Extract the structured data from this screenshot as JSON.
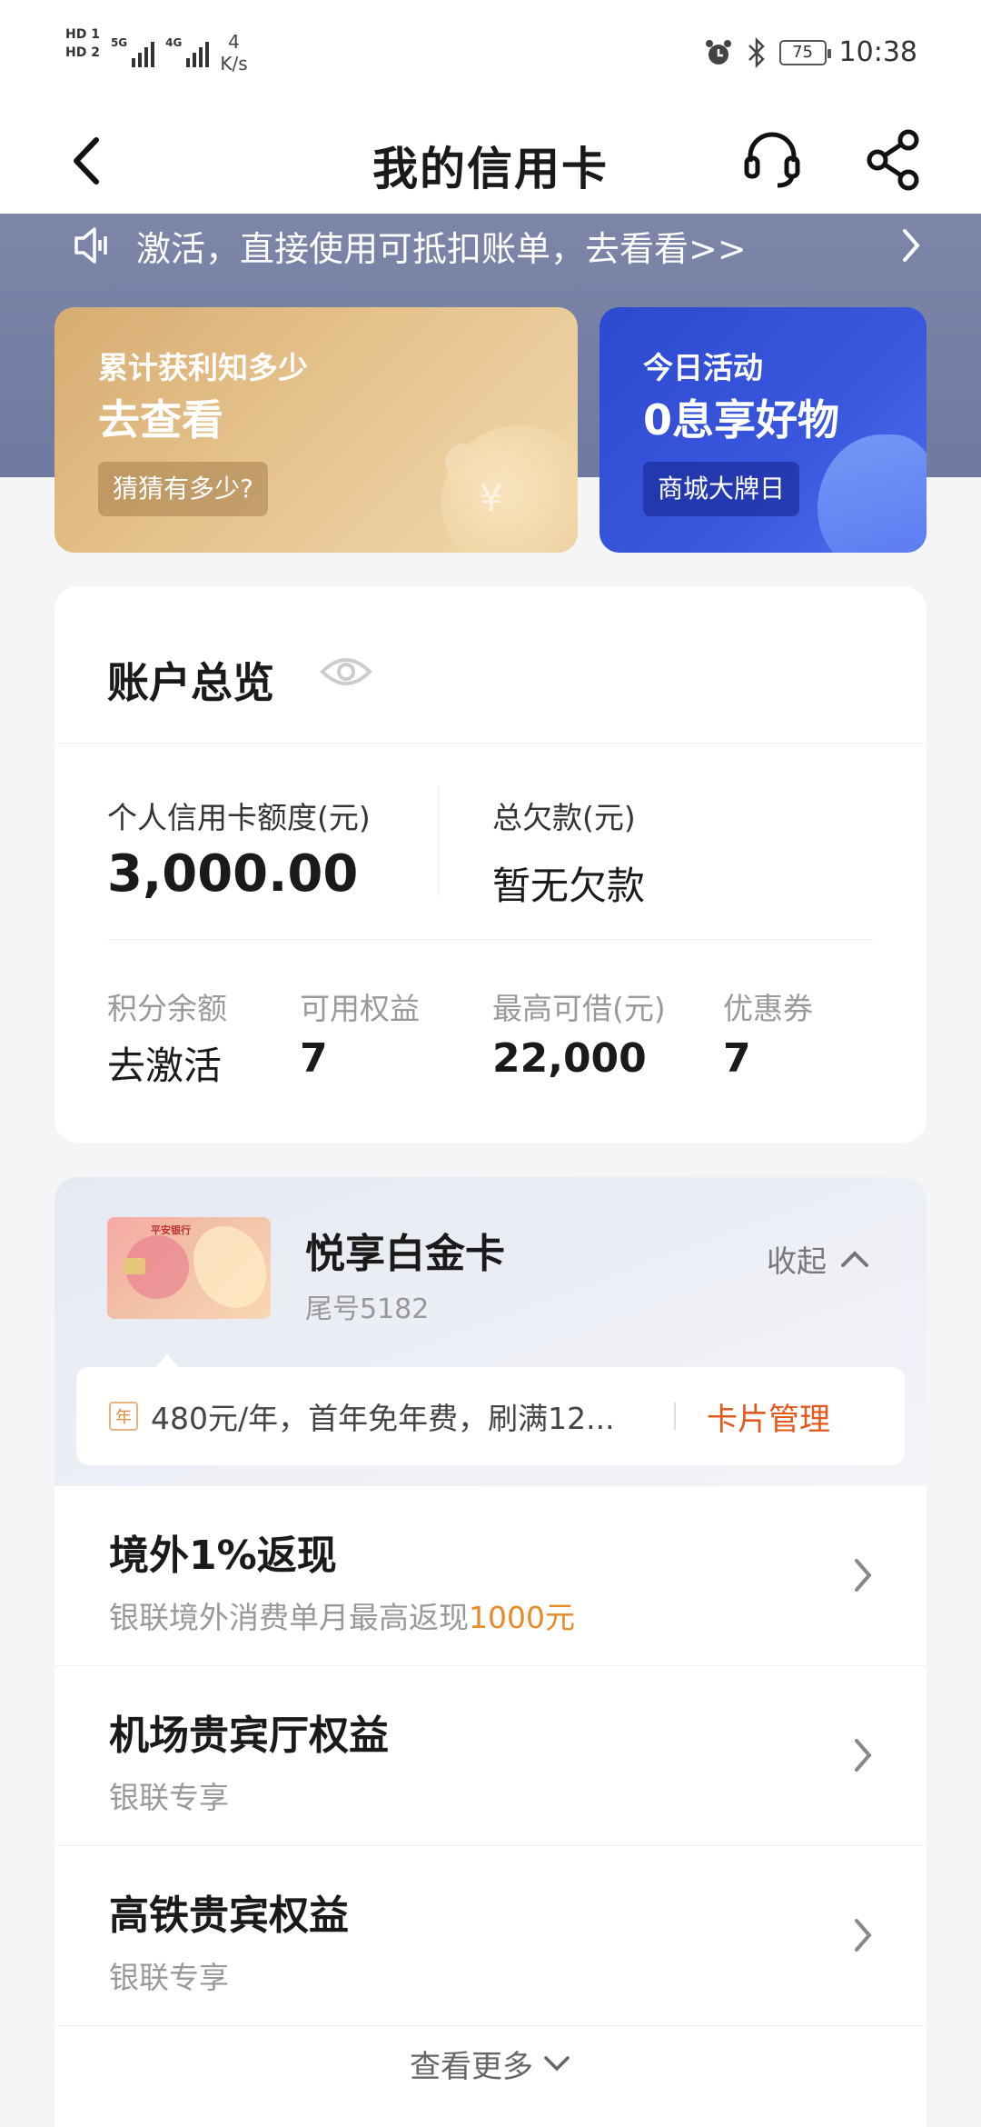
{
  "status_bar": {
    "hd1": "HD 1",
    "hd2": "HD 2",
    "sig1": "5G",
    "sig2": "4G",
    "net_speed_value": "4",
    "net_speed_unit": "K/s",
    "battery": "75",
    "time": "10:38"
  },
  "header": {
    "title": "我的信用卡"
  },
  "marquee": {
    "text": "激活，直接使用可抵扣账单，去看看>>"
  },
  "promo_left": {
    "line1": "累计获利知多少",
    "line2": "去查看",
    "chip": "猜猜有多少?",
    "coin_symbol": "¥"
  },
  "promo_right": {
    "line1": "今日活动",
    "line2": "0息享好物",
    "chip": "商城大牌日"
  },
  "account": {
    "title": "账户总览",
    "credit_limit_label": "个人信用卡额度(元)",
    "credit_limit_value": "3,000.00",
    "total_debt_label": "总欠款(元)",
    "total_debt_value": "暂无欠款",
    "points_label": "积分余额",
    "points_value": "去激活",
    "benefits_label": "可用权益",
    "benefits_value": "7",
    "max_loan_label": "最高可借(元)",
    "max_loan_value": "22,000",
    "coupons_label": "优惠券",
    "coupons_value": "7"
  },
  "card": {
    "bank_text": "平安银行",
    "name": "悦享白金卡",
    "tail": "尾号5182",
    "collapse_label": "收起",
    "year_badge": "年",
    "fee_text": "480元/年，首年免年费，刷满12...",
    "manage_label": "卡片管理"
  },
  "benefits": [
    {
      "title": "境外1%返现",
      "sub": "银联境外消费单月最高返现",
      "highlight": "1000元"
    },
    {
      "title": "机场贵宾厅权益",
      "sub": "银联专享",
      "highlight": ""
    },
    {
      "title": "高铁贵宾权益",
      "sub": "银联专享",
      "highlight": ""
    }
  ],
  "more_label": "查看更多",
  "colors": {
    "accent_orange": "#e4591b",
    "highlight_orange": "#e98a28",
    "band": "#7d86a8",
    "promo_gold": "#d7ad72",
    "promo_blue": "#3a57de"
  }
}
